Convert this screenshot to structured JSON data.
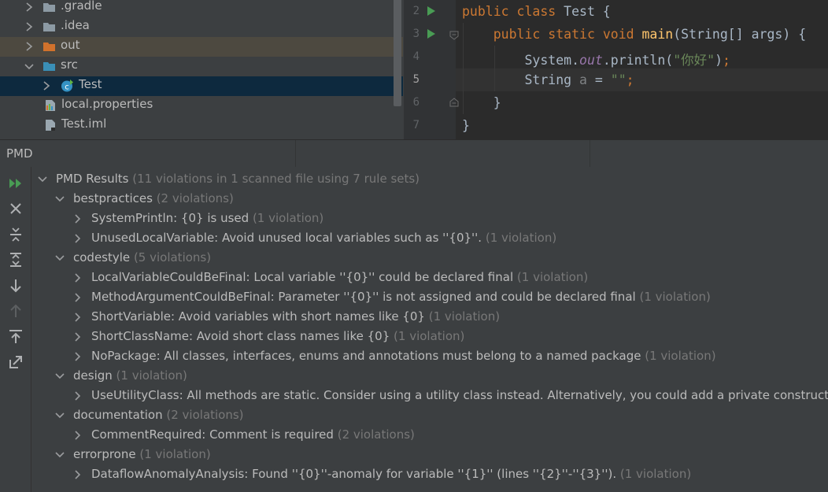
{
  "project_tree": {
    "items": [
      {
        "label": ".gradle",
        "kind": "folder",
        "expanded": false
      },
      {
        "label": ".idea",
        "kind": "folder",
        "expanded": false
      },
      {
        "label": "out",
        "kind": "folder-excluded",
        "expanded": false
      },
      {
        "label": "src",
        "kind": "folder-source",
        "expanded": true
      },
      {
        "label": "Test",
        "kind": "java-class",
        "expanded": false
      },
      {
        "label": "local.properties",
        "kind": "properties-file"
      },
      {
        "label": "Test.iml",
        "kind": "iml-file"
      }
    ]
  },
  "editor": {
    "current_line": "5",
    "lines": [
      {
        "number": "2",
        "code": "public class Test {"
      },
      {
        "number": "3",
        "code": "    public static void main(String[] args) {"
      },
      {
        "number": "4",
        "code": "        System.out.println(\"你好\");"
      },
      {
        "number": "5",
        "code": "        String a = \"\";"
      },
      {
        "number": "6",
        "code": "    }"
      },
      {
        "number": "7",
        "code": "}"
      }
    ]
  },
  "tool_window": {
    "title": "PMD"
  },
  "toolbar": {
    "buttons": [
      "rerun-icon",
      "close-icon",
      "collapse-all-icon",
      "expand-all-icon",
      "next-icon",
      "previous-icon",
      "export-icon",
      "autoscroll-icon"
    ]
  },
  "results": {
    "root": {
      "label": "PMD Results",
      "count": "(11 violations in 1 scanned file using 7 rule sets)"
    },
    "groups": [
      {
        "name": "bestpractices",
        "count": "(2 violations)",
        "rules": [
          {
            "label": "SystemPrintln: {0} is used",
            "count": "(1 violation)"
          },
          {
            "label": "UnusedLocalVariable: Avoid unused local variables such as ''{0}''.",
            "count": "(1 violation)"
          }
        ]
      },
      {
        "name": "codestyle",
        "count": "(5 violations)",
        "rules": [
          {
            "label": "LocalVariableCouldBeFinal: Local variable ''{0}'' could be declared final",
            "count": "(1 violation)"
          },
          {
            "label": "MethodArgumentCouldBeFinal: Parameter ''{0}'' is not assigned and could be declared final",
            "count": "(1 violation)"
          },
          {
            "label": "ShortVariable: Avoid variables with short names like {0}",
            "count": "(1 violation)"
          },
          {
            "label": "ShortClassName: Avoid short class names like {0}",
            "count": "(1 violation)"
          },
          {
            "label": "NoPackage: All classes, interfaces, enums and annotations must belong to a named package",
            "count": "(1 violation)"
          }
        ]
      },
      {
        "name": "design",
        "count": "(1 violation)",
        "rules": [
          {
            "label": "UseUtilityClass: All methods are static.  Consider using a utility class instead. Alternatively, you could add a private constructor or",
            "count": ""
          }
        ]
      },
      {
        "name": "documentation",
        "count": "(2 violations)",
        "rules": [
          {
            "label": "CommentRequired: Comment is required",
            "count": "(2 violations)"
          }
        ]
      },
      {
        "name": "errorprone",
        "count": "(1 violation)",
        "rules": [
          {
            "label": "DataflowAnomalyAnalysis: Found ''{0}''-anomaly for variable ''{1}'' (lines ''{2}''-''{3}'').",
            "count": "(1 violation)"
          }
        ]
      }
    ]
  },
  "colors": {
    "background": "#3c3f41",
    "editor_background": "#2b2b2b",
    "selection": "#0d293e",
    "keyword": "#cc7832",
    "string": "#6a8759",
    "run_green": "#499c54",
    "count_gray": "#787878"
  }
}
